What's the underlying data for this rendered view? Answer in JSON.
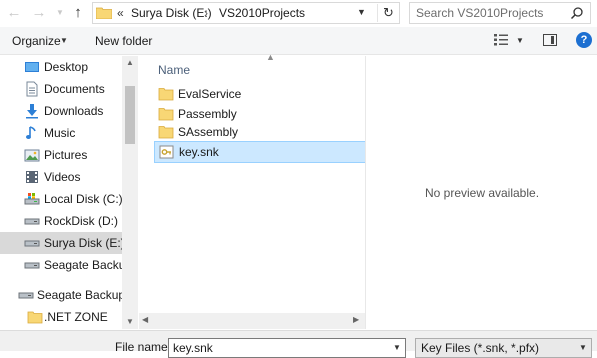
{
  "address_bar": {
    "back_icon": "arrow-left-icon",
    "forward_icon": "arrow-right-icon",
    "recent_icon": "chevron-down-icon",
    "up_icon": "arrow-up-icon",
    "overflow": "«",
    "breadcrumbs": [
      "Surya Disk (E:)",
      "VS2010Projects"
    ],
    "separator": "›",
    "dropdown_icon": "chevron-down-icon",
    "refresh_icon": "refresh-icon"
  },
  "search": {
    "placeholder": "Search VS2010Projects"
  },
  "toolbar": {
    "organize_label": "Organize",
    "new_folder_label": "New folder",
    "help_label": "?"
  },
  "navigation": {
    "items": [
      {
        "label": "Desktop",
        "icon": "desktop-icon"
      },
      {
        "label": "Documents",
        "icon": "documents-icon"
      },
      {
        "label": "Downloads",
        "icon": "download-icon"
      },
      {
        "label": "Music",
        "icon": "music-icon"
      },
      {
        "label": "Pictures",
        "icon": "pictures-icon"
      },
      {
        "label": "Videos",
        "icon": "videos-icon"
      },
      {
        "label": "Local Disk (C:)",
        "icon": "drive-c-icon"
      },
      {
        "label": "RockDisk (D:)",
        "icon": "drive-icon"
      },
      {
        "label": "Surya Disk (E:)",
        "icon": "drive-icon",
        "selected": true
      },
      {
        "label": "Seagate Backup",
        "icon": "drive-icon"
      },
      {
        "label": "Seagate Backup P",
        "icon": "drive-icon"
      },
      {
        "label": ".NET ZONE",
        "icon": "folder-icon"
      }
    ]
  },
  "file_list": {
    "column_name": "Name",
    "items": [
      {
        "name": "EvalService",
        "type": "folder"
      },
      {
        "name": "Passembly",
        "type": "folder"
      },
      {
        "name": "SAssembly",
        "type": "folder"
      },
      {
        "name": "key.snk",
        "type": "snk-file",
        "selected": true
      }
    ]
  },
  "preview": {
    "text": "No preview available."
  },
  "bottom": {
    "file_name_label": "File name:",
    "file_name_value": "key.snk",
    "file_type_value": "Key Files (*.snk, *.pfx)"
  },
  "colors": {
    "selection_bg": "#cce8ff",
    "nav_selected_bg": "#d9d9d9",
    "folder_yellow": "#f8d775",
    "accent_blue": "#1c6fd1"
  }
}
